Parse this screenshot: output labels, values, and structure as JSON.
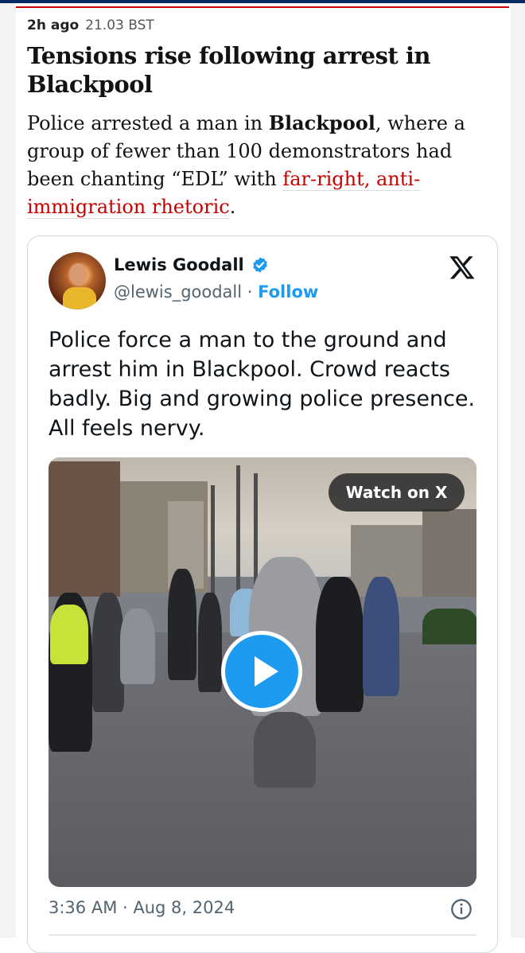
{
  "article": {
    "meta": {
      "ago": "2h ago",
      "time": "21.03 BST"
    },
    "headline": "Tensions rise following arrest in Blackpool",
    "body": {
      "part1": "Police arrested a man in ",
      "bold": "Blackpool",
      "part2": ", where a group of fewer than 100 demonstrators had been chanting “EDL” with ",
      "link": "far-right, anti-immigration rhetoric",
      "part3": "."
    }
  },
  "tweet": {
    "author_name": "Lewis Goodall",
    "handle": "@lewis_goodall",
    "separator": " · ",
    "follow_label": "Follow",
    "text": "Police force a man to the ground and arrest him in Blackpool. Crowd reacts badly. Big and growing police presence. All feels nervy.",
    "video": {
      "watch_label": "Watch on X"
    },
    "timestamp": "3:36 AM · Aug 8, 2024"
  },
  "icons": {
    "verified": "verified-badge-icon",
    "x_logo": "x-logo-icon",
    "play": "play-icon",
    "info": "info-icon"
  },
  "colors": {
    "guardian_red": "#c70000",
    "twitter_blue": "#1d9bf0",
    "text": "#121212"
  }
}
